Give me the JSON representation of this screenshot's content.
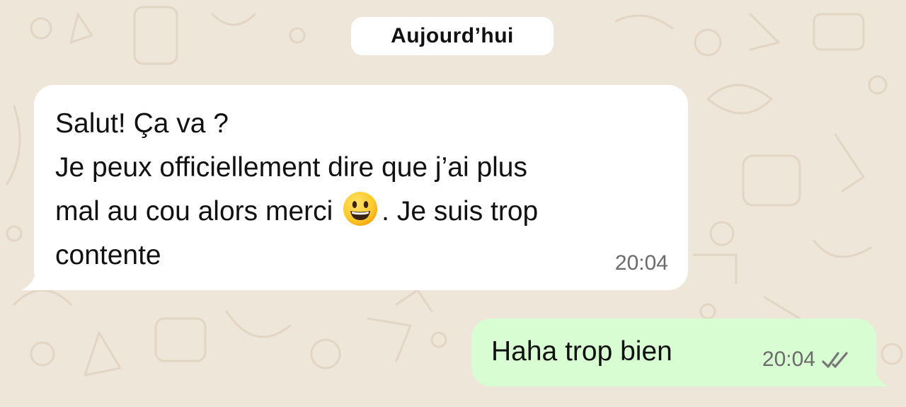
{
  "chat": {
    "date_separator": "Aujourd’hui",
    "messages": [
      {
        "direction": "incoming",
        "lines": [
          "Salut! Ça va ?",
          "Je peux officiellement dire que j’ai plus",
          "mal au cou alors merci",
          ". Je suis trop",
          "contente"
        ],
        "emoji": "grinning-face",
        "time": "20:04"
      },
      {
        "direction": "outgoing",
        "text": "Haha trop bien",
        "time": "20:04",
        "status_icon": "double-check-icon"
      }
    ]
  },
  "colors": {
    "wallpaper": "#efe6da",
    "incoming_bubble": "#ffffff",
    "outgoing_bubble": "#d9fdd3",
    "time_text": "#6b6b6b"
  }
}
